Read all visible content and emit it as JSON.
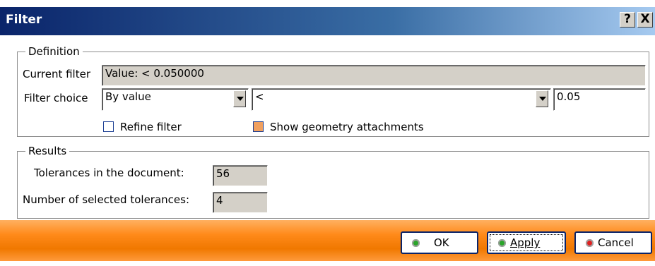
{
  "window": {
    "title": "Filter",
    "help": "?",
    "close": "X"
  },
  "definition": {
    "legend": "Definition",
    "current_filter_label": "Current filter",
    "current_filter_value": "Value: < 0.050000",
    "filter_choice_label": "Filter choice",
    "filter_type": "By value",
    "operator": "<",
    "threshold": "0.05",
    "refine_filter": {
      "label": "Refine filter",
      "checked": false
    },
    "show_geometry": {
      "label": "Show geometry attachments",
      "checked": true
    }
  },
  "results": {
    "legend": "Results",
    "tolerances_label": "Tolerances in the document:",
    "tolerances_value": "56",
    "selected_label": "Number of selected tolerances:",
    "selected_value": "4"
  },
  "buttons": {
    "ok": "OK",
    "apply": "Apply",
    "cancel": "Cancel"
  },
  "colors": {
    "ok_dot": "#2aa52a",
    "apply_dot": "#2aa52a",
    "cancel_dot": "#e02020",
    "bar": "#f07800"
  }
}
